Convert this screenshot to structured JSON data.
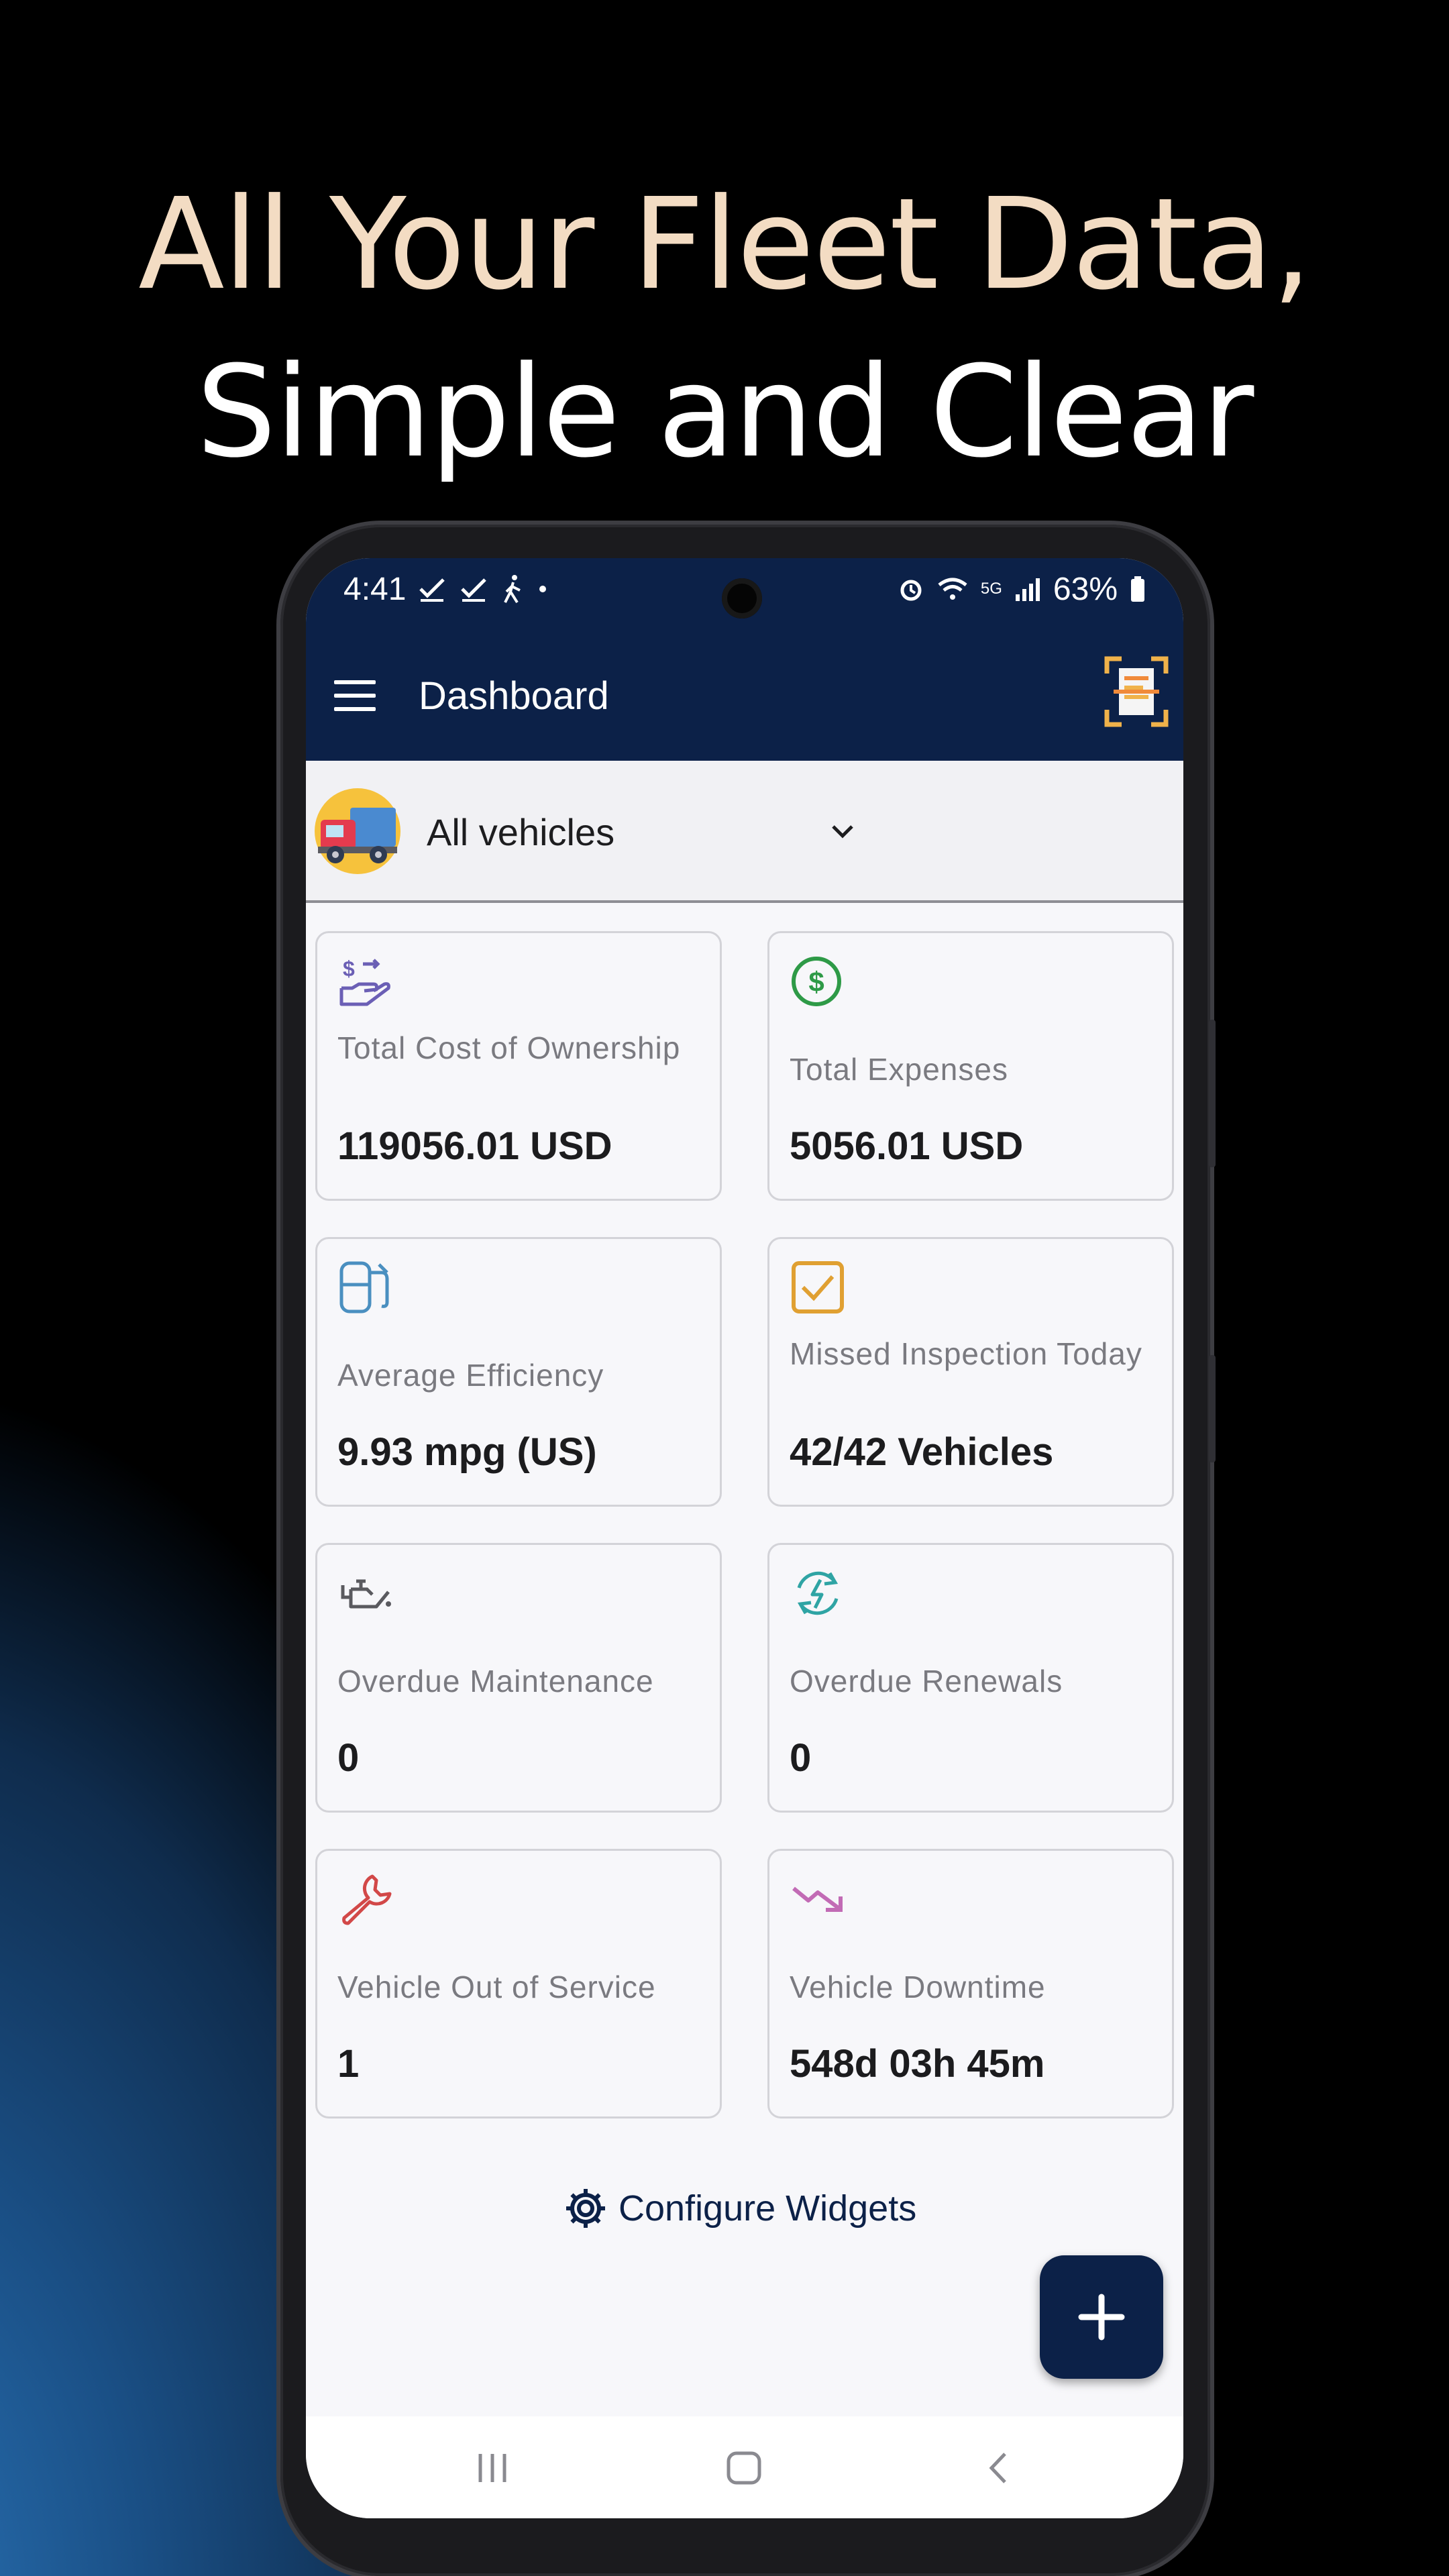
{
  "headline": {
    "line1": "All Your Fleet Data,",
    "line2": "Simple and Clear"
  },
  "status_bar": {
    "time": "4:41",
    "battery": "63%",
    "network": "5G"
  },
  "app_bar": {
    "title": "Dashboard",
    "menu_icon": "hamburger-menu-icon",
    "action_icon": "document-scan-icon"
  },
  "vehicle_selector": {
    "label": "All vehicles",
    "icon": "truck-icon"
  },
  "widgets": [
    {
      "label": "Total Cost of Ownership",
      "value": "119056.01 USD",
      "icon": "cost-hand-icon",
      "color": "#6b5fb5"
    },
    {
      "label": "Total Expenses",
      "value": "5056.01 USD",
      "icon": "dollar-circle-icon",
      "color": "#2e9a47"
    },
    {
      "label": "Average Efficiency",
      "value": "9.93 mpg (US)",
      "icon": "fuel-pump-icon",
      "color": "#4a8fc0"
    },
    {
      "label": "Missed Inspection Today",
      "value": "42/42 Vehicles",
      "icon": "checkbox-icon",
      "color": "#e0a032"
    },
    {
      "label": "Overdue Maintenance",
      "value": "0",
      "icon": "oil-can-icon",
      "color": "#5a5a5f"
    },
    {
      "label": "Overdue Renewals",
      "value": "0",
      "icon": "renew-bolt-icon",
      "color": "#2fa4a4"
    },
    {
      "label": "Vehicle Out of Service",
      "value": "1",
      "icon": "wrench-icon",
      "color": "#d24848"
    },
    {
      "label": "Vehicle Downtime",
      "value": "548d 03h 45m",
      "icon": "trend-down-icon",
      "color": "#c26bb5"
    }
  ],
  "configure": {
    "label": "Configure Widgets",
    "icon": "gear-icon"
  },
  "fab": {
    "label": "+"
  },
  "colors": {
    "primary": "#0c2148",
    "headline_line1": "#f3dcc3",
    "background": "#000000"
  }
}
